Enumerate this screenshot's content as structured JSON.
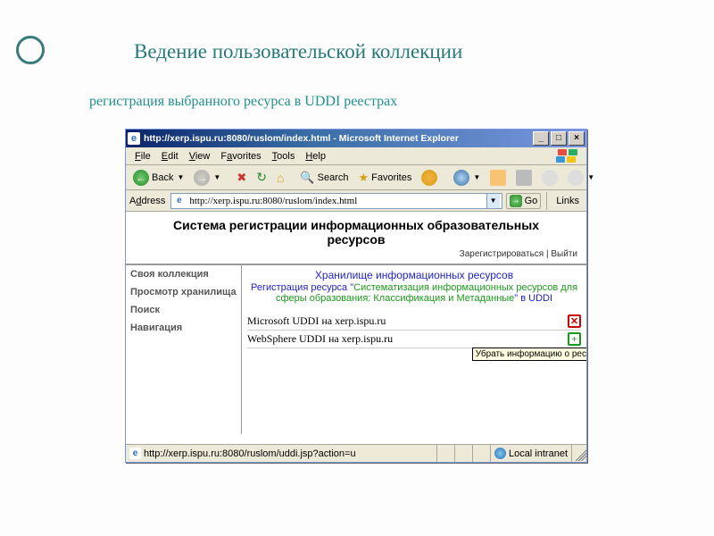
{
  "slide": {
    "title": "Ведение пользовательской коллекции",
    "subtitle": "регистрация выбранного ресурса в UDDI реестрах"
  },
  "window": {
    "title": "http://xerp.ispu.ru:8080/ruslom/index.html - Microsoft Internet Explorer",
    "minimize": "_",
    "maximize": "□",
    "close": "×"
  },
  "menu": {
    "file": "File",
    "edit": "Edit",
    "view": "View",
    "favorites": "Favorites",
    "tools": "Tools",
    "help": "Help"
  },
  "toolbar": {
    "back": "Back",
    "search": "Search",
    "favorites": "Favorites"
  },
  "address": {
    "label": "Address",
    "url": "http://xerp.ispu.ru:8080/ruslom/index.html",
    "go": "Go",
    "links": "Links"
  },
  "page": {
    "title1": "Система регистрации информационных образовательных",
    "title2": "ресурсов",
    "register_link": "Зарегистрироваться",
    "sep": " | ",
    "logout_link": "Выйти"
  },
  "sidebar": {
    "items": [
      "Своя коллекция",
      "Просмотр хранилища",
      "Поиск",
      "Навигация"
    ]
  },
  "main": {
    "storage_title": "Хранилище информационных ресурсов",
    "reg_prefix": "Регистрация ресурса \"",
    "reg_name": "Систематизация информационных ресурсов для сферы образования: Классификация и Метаданные",
    "reg_suffix": "\" в UDDI",
    "rows": [
      {
        "label": "Microsoft UDDI на xerp.ispu.ru",
        "action": "delete"
      },
      {
        "label": "WebSphere UDDI на xerp.ispu.ru",
        "action": "add"
      }
    ],
    "tooltip": "Убрать информацию о рес"
  },
  "status": {
    "url": "http://xerp.ispu.ru:8080/ruslom/uddi.jsp?action=u",
    "zone": "Local intranet"
  }
}
